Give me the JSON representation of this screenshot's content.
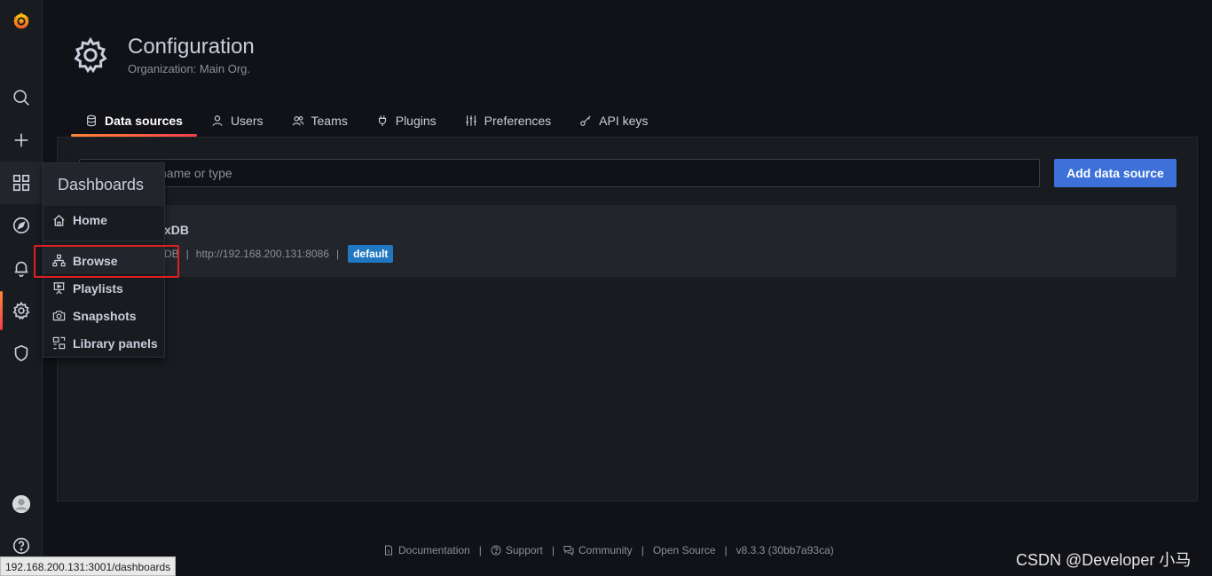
{
  "header": {
    "title": "Configuration",
    "subtitle": "Organization: Main Org."
  },
  "tabs": [
    {
      "label": "Data sources",
      "icon": "database-icon",
      "active": true
    },
    {
      "label": "Users",
      "icon": "user-icon"
    },
    {
      "label": "Teams",
      "icon": "users-icon"
    },
    {
      "label": "Plugins",
      "icon": "plug-icon"
    },
    {
      "label": "Preferences",
      "icon": "sliders-icon"
    },
    {
      "label": "API keys",
      "icon": "key-icon"
    }
  ],
  "search": {
    "placeholder_visible": "name or type"
  },
  "add_button": {
    "label": "Add data source"
  },
  "datasource": {
    "name_visible": "xDB",
    "type_visible": "DB",
    "url": "http://192.168.200.131:8086",
    "badge": "default"
  },
  "dropdown": {
    "title": "Dashboards",
    "items": [
      {
        "label": "Home",
        "icon": "home-icon"
      },
      {
        "label": "Browse",
        "icon": "sitemap-icon"
      },
      {
        "label": "Playlists",
        "icon": "presentation-icon"
      },
      {
        "label": "Snapshots",
        "icon": "camera-icon"
      },
      {
        "label": "Library panels",
        "icon": "library-panels-icon"
      }
    ]
  },
  "footer": {
    "documentation": "Documentation",
    "support": "Support",
    "community": "Community",
    "open_source": "Open Source",
    "version": "v8.3.3 (30bb7a93ca)",
    "separator": "|"
  },
  "statusbar": {
    "url": "192.168.200.131:3001/dashboards"
  },
  "watermark": "CSDN @Developer 小马",
  "colors": {
    "accent": "#3d71d9",
    "badge": "#1f78c1",
    "highlight_box": "#e02020",
    "grafana_orange": "#f05a28"
  }
}
